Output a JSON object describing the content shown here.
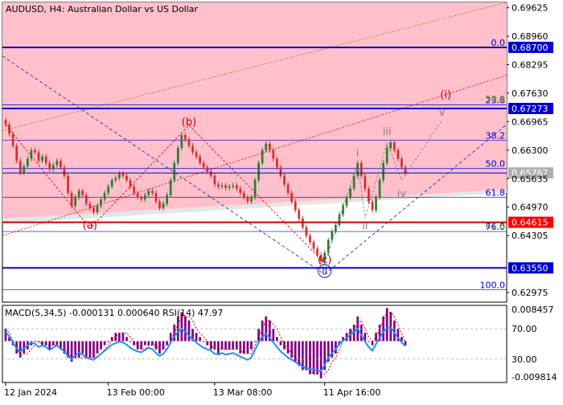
{
  "chart_title": "AUDUSD, H4:  Australian Dollar vs US Dollar",
  "colors": {
    "pink_zone": "#ffc0cb",
    "grey_zone": "#d9d9d9",
    "bull_candle": "#2e7d32",
    "bear_candle": "#d32f2f",
    "wave_red": "#cc0000",
    "wave_grey": "#808080",
    "wave_blue": "#1a1aaa",
    "level_blue": "#0000cc",
    "price_red": "#ff0000",
    "macd_hist": "#800080",
    "macd_signal": "#cc0000",
    "rsi_line": "#1e90ff",
    "grid": "#000000"
  },
  "chart_data": [
    {
      "type": "line",
      "title": "AUDUSD, H4:  Australian Dollar vs US Dollar",
      "ylim": [
        0.6275,
        0.6975
      ],
      "y_ticks": [
        "0.69625",
        "0.68960",
        "0.68295",
        "0.67630",
        "0.66965",
        "0.66300",
        "0.65635",
        "0.64970",
        "0.64305",
        "0.62975"
      ],
      "y_tick_values": [
        0.69625,
        0.6896,
        0.68295,
        0.6763,
        0.66965,
        0.663,
        0.65635,
        0.6497,
        0.64305,
        0.62975
      ],
      "price_labels": [
        {
          "label": "0.68700",
          "value": 0.687,
          "style": "blue"
        },
        {
          "label": "0.67273",
          "value": 0.67273,
          "style": "blue"
        },
        {
          "label": "0.65767",
          "value": 0.65767,
          "style": "grey"
        },
        {
          "label": "0.64615",
          "value": 0.64615,
          "style": "red"
        },
        {
          "label": "0.63550",
          "value": 0.6355,
          "style": "blue"
        }
      ],
      "fib_levels": [
        {
          "label": "0.0",
          "value": 0.687
        },
        {
          "label": "23.6",
          "value": 0.6736
        },
        {
          "label": "38.2",
          "value": 0.6653
        },
        {
          "label": "50.0",
          "value": 0.6587
        },
        {
          "label": "61.8",
          "value": 0.652
        },
        {
          "label": "76.0",
          "value": 0.644
        },
        {
          "label": "100.0",
          "value": 0.6304
        }
      ],
      "extension_levels": [
        {
          "label": "50.0",
          "value": 0.6761
        },
        {
          "label": "61.8",
          "value": 0.6465
        }
      ],
      "x_labels": [
        "12 Jan 2024",
        "13 Feb 00:00",
        "13 Mar 08:00",
        "11 Apr 16:00"
      ],
      "wave_labels": [
        {
          "label": "(a)",
          "x": 23,
          "y": 0.6447,
          "color": "red"
        },
        {
          "label": "(b)",
          "x": 50,
          "y": 0.6688,
          "color": "red"
        },
        {
          "label": "(c)",
          "x": 87,
          "y": 0.6366,
          "color": "red"
        },
        {
          "label": "ii",
          "x": 87,
          "y": 0.634,
          "color": "blue"
        },
        {
          "label": "i",
          "x": 96,
          "y": 0.6615,
          "color": "grey"
        },
        {
          "label": "ii",
          "x": 98,
          "y": 0.6445,
          "color": "grey"
        },
        {
          "label": "iii",
          "x": 104,
          "y": 0.6665,
          "color": "grey"
        },
        {
          "label": "iv",
          "x": 108,
          "y": 0.652,
          "color": "grey"
        },
        {
          "label": "v",
          "x": 119,
          "y": 0.671,
          "color": "grey"
        },
        {
          "label": "(i)",
          "x": 120,
          "y": 0.6752,
          "color": "red"
        }
      ],
      "ohlc_close": [
        0.669,
        0.6668,
        0.664,
        0.6605,
        0.6578,
        0.6592,
        0.661,
        0.663,
        0.6625,
        0.6605,
        0.6615,
        0.66,
        0.6585,
        0.6595,
        0.6605,
        0.659,
        0.657,
        0.653,
        0.65,
        0.652,
        0.6535,
        0.6525,
        0.6505,
        0.6495,
        0.6485,
        0.65,
        0.6515,
        0.653,
        0.6545,
        0.656,
        0.6565,
        0.6575,
        0.657,
        0.656,
        0.6545,
        0.653,
        0.652,
        0.6515,
        0.6525,
        0.6535,
        0.653,
        0.651,
        0.6495,
        0.6505,
        0.6525,
        0.656,
        0.66,
        0.6635,
        0.6665,
        0.6655,
        0.664,
        0.6625,
        0.6615,
        0.66,
        0.659,
        0.658,
        0.657,
        0.655,
        0.6545,
        0.6548,
        0.6542,
        0.6545,
        0.6548,
        0.654,
        0.653,
        0.652,
        0.651,
        0.652,
        0.656,
        0.66,
        0.663,
        0.6645,
        0.663,
        0.661,
        0.659,
        0.657,
        0.655,
        0.653,
        0.651,
        0.649,
        0.647,
        0.645,
        0.643,
        0.6415,
        0.64,
        0.6385,
        0.637,
        0.639,
        0.642,
        0.644,
        0.6455,
        0.648,
        0.65,
        0.652,
        0.654,
        0.657,
        0.66,
        0.657,
        0.654,
        0.651,
        0.649,
        0.652,
        0.656,
        0.66,
        0.6635,
        0.6648,
        0.663,
        0.661,
        0.659,
        0.6577
      ],
      "macd": {
        "label": "MACD(5,34,5) -0.000131 0.000640 RSI(14) 47.97",
        "y_ticks": [
          "0.008457",
          "70.00",
          "30.00",
          "-0.009814"
        ],
        "ylim": [
          -0.009814,
          0.008457
        ],
        "histogram": [
          0.003,
          0.001,
          -0.001,
          -0.003,
          -0.004,
          -0.003,
          -0.002,
          -0.001,
          0.0,
          0.0,
          -0.001,
          -0.001,
          -0.002,
          -0.001,
          -0.001,
          -0.002,
          -0.003,
          -0.004,
          -0.005,
          -0.004,
          -0.004,
          -0.003,
          -0.004,
          -0.004,
          -0.004,
          -0.003,
          -0.002,
          -0.001,
          0.0,
          0.001,
          0.002,
          0.002,
          0.002,
          0.001,
          0.0,
          -0.001,
          -0.002,
          -0.002,
          -0.001,
          -0.001,
          -0.001,
          -0.002,
          -0.003,
          -0.002,
          -0.001,
          0.002,
          0.004,
          0.006,
          0.007,
          0.006,
          0.005,
          0.003,
          0.002,
          0.001,
          0.0,
          -0.001,
          -0.002,
          -0.002,
          -0.003,
          -0.002,
          -0.002,
          -0.002,
          -0.002,
          -0.002,
          -0.003,
          -0.003,
          -0.003,
          -0.002,
          0.0,
          0.003,
          0.005,
          0.006,
          0.005,
          0.003,
          0.001,
          -0.001,
          -0.002,
          -0.003,
          -0.004,
          -0.005,
          -0.006,
          -0.007,
          -0.007,
          -0.008,
          -0.008,
          -0.008,
          -0.009,
          -0.007,
          -0.005,
          -0.004,
          -0.003,
          -0.001,
          0.001,
          0.002,
          0.003,
          0.004,
          0.006,
          0.004,
          0.002,
          0.0,
          -0.001,
          0.002,
          0.004,
          0.006,
          0.008,
          0.007,
          0.005,
          0.003,
          0.001,
          -0.001
        ],
        "rsi": [
          66,
          60,
          52,
          44,
          40,
          44,
          48,
          52,
          50,
          46,
          48,
          46,
          42,
          45,
          48,
          44,
          40,
          34,
          30,
          35,
          38,
          36,
          32,
          30,
          29,
          33,
          37,
          41,
          45,
          49,
          51,
          53,
          52,
          49,
          45,
          42,
          40,
          39,
          42,
          45,
          43,
          38,
          34,
          37,
          43,
          52,
          60,
          66,
          70,
          66,
          61,
          56,
          52,
          48,
          45,
          43,
          41,
          37,
          36,
          38,
          36,
          37,
          38,
          36,
          33,
          31,
          29,
          32,
          42,
          52,
          60,
          63,
          58,
          52,
          46,
          40,
          36,
          32,
          29,
          26,
          23,
          20,
          18,
          17,
          16,
          15,
          14,
          22,
          32,
          38,
          43,
          50,
          54,
          58,
          62,
          66,
          70,
          62,
          53,
          46,
          41,
          50,
          58,
          66,
          71,
          72,
          65,
          58,
          52,
          47
        ],
        "signal": [
          0.003,
          0.002,
          0.0,
          -0.002,
          -0.003,
          -0.003,
          -0.003,
          -0.002,
          -0.001,
          0.0,
          -0.001,
          -0.001,
          -0.001,
          -0.001,
          -0.001,
          -0.002,
          -0.002,
          -0.003,
          -0.004,
          -0.004,
          -0.004,
          -0.004,
          -0.004,
          -0.004,
          -0.004,
          -0.004,
          -0.003,
          -0.002,
          -0.001,
          0.0,
          0.001,
          0.002,
          0.002,
          0.002,
          0.001,
          0.0,
          -0.001,
          -0.002,
          -0.002,
          -0.001,
          -0.001,
          -0.001,
          -0.002,
          -0.002,
          -0.002,
          0.0,
          0.002,
          0.004,
          0.006,
          0.006,
          0.006,
          0.005,
          0.003,
          0.002,
          0.001,
          0.0,
          -0.001,
          -0.002,
          -0.002,
          -0.002,
          -0.002,
          -0.002,
          -0.002,
          -0.002,
          -0.002,
          -0.003,
          -0.003,
          -0.003,
          -0.001,
          0.001,
          0.003,
          0.005,
          0.005,
          0.004,
          0.003,
          0.001,
          -0.001,
          -0.002,
          -0.003,
          -0.004,
          -0.005,
          -0.006,
          -0.007,
          -0.007,
          -0.008,
          -0.008,
          -0.008,
          -0.008,
          -0.007,
          -0.005,
          -0.004,
          -0.002,
          0.0,
          0.001,
          0.002,
          0.003,
          0.004,
          0.005,
          0.003,
          0.001,
          0.0,
          0.001,
          0.003,
          0.005,
          0.007,
          0.007,
          0.006,
          0.004,
          0.002,
          0.0
        ]
      }
    }
  ]
}
